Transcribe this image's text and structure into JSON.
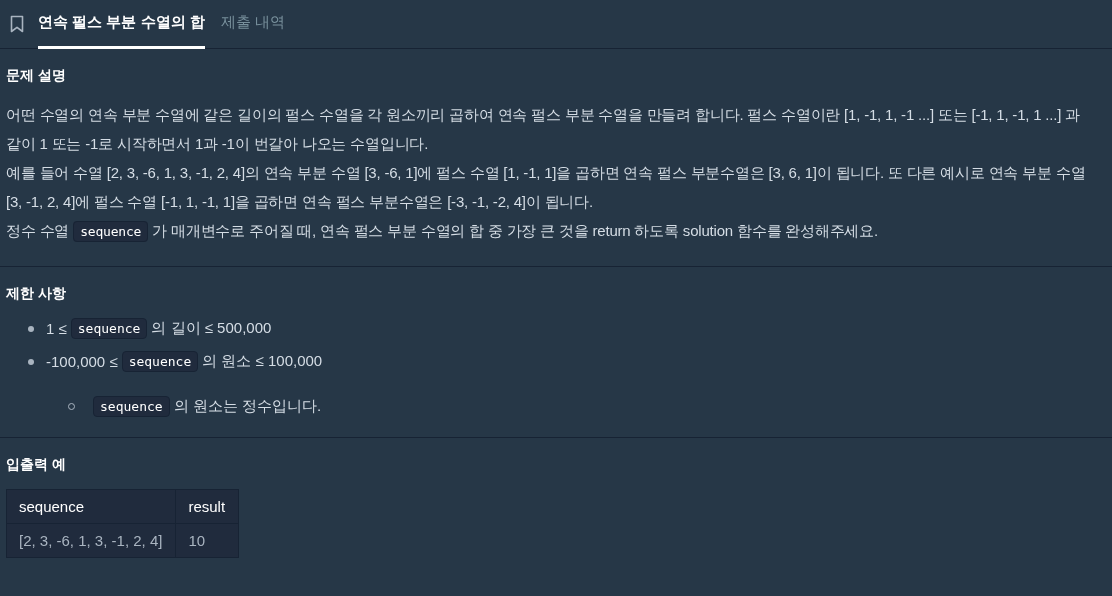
{
  "tabs": [
    {
      "label": "연속 펄스 부분 수열의 합",
      "selected": true
    },
    {
      "label": "제출 내역",
      "selected": false
    }
  ],
  "sections": [
    {
      "kind": "text",
      "heading": "문제 설명",
      "paragraphs": [
        [
          {
            "kind": "text",
            "text": "어떤 수열의 연속 부분 수열에 같은 길이의 펄스 수열을 각 원소끼리 곱하여 연속 펄스 부분 수열을 만들려 합니다. 펄스 수열이란 [1, -1, 1, -1 ...] 또는 [-1, 1, -1, 1 ...] 과 같이 1 또는 -1로 시작하면서 1과 -1이 번갈아 나오는 수열입니다."
          }
        ],
        [
          {
            "kind": "text",
            "text": "예를 들어 수열 [2, 3, -6, 1, 3, -1, 2, 4]의 연속 부분 수열 [3, -6, 1]에 펄스 수열 [1, -1, 1]을 곱하면 연속 펄스 부분수열은 [3, 6, 1]이 됩니다. 또 다른 예시로 연속 부분 수열 [3, -1, 2, 4]에 펄스 수열 [-1, 1, -1, 1]을 곱하면 연속 펄스 부분수열은 [-3, -1, -2, 4]이 됩니다."
          }
        ],
        [
          {
            "kind": "text",
            "text": "정수 수열"
          },
          {
            "kind": "code",
            "text": "sequence"
          },
          {
            "kind": "text",
            "text": "가 매개변수로 주어질 때, 연속 펄스 부분 수열의 합 중 가장 큰 것을 return 하도록 solution 함수를 완성해주세요."
          }
        ]
      ]
    },
    {
      "kind": "list",
      "heading": "제한 사항",
      "items": [
        {
          "segments": [
            {
              "kind": "text",
              "text": "1 ≤"
            },
            {
              "kind": "code",
              "text": "sequence"
            },
            {
              "kind": "text",
              "text": "의 길이 ≤ 500,000"
            }
          ]
        },
        {
          "segments": [
            {
              "kind": "text",
              "text": "-100,000 ≤"
            },
            {
              "kind": "code",
              "text": "sequence"
            },
            {
              "kind": "text",
              "text": "의 원소 ≤ 100,000"
            }
          ],
          "children": [
            {
              "segments": [
                {
                  "kind": "code",
                  "text": "sequence"
                },
                {
                  "kind": "text",
                  "text": "의 원소는 정수입니다."
                }
              ]
            }
          ]
        }
      ]
    },
    {
      "kind": "table",
      "heading": "입출력 예",
      "columns": [
        "sequence",
        "result"
      ],
      "rows": [
        [
          "[2, 3, -6, 1, 3, -1, 2, 4]",
          "10"
        ]
      ]
    }
  ]
}
